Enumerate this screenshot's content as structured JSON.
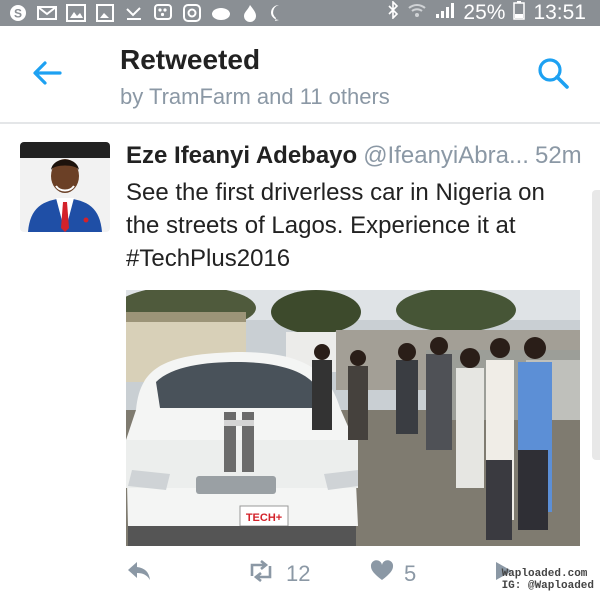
{
  "status_bar": {
    "battery": "25%",
    "time": "13:51",
    "icons": [
      "skype-icon",
      "mail-icon",
      "gallery-icon",
      "image-icon",
      "missed-call-icon",
      "bbm-icon",
      "instagram-icon",
      "cloud-icon",
      "fire-icon",
      "messenger-icon",
      "bluetooth-icon",
      "wifi-icon",
      "signal-icon",
      "battery-icon"
    ]
  },
  "header": {
    "title": "Retweeted",
    "subtitle": "by TramFarm and 11 others"
  },
  "tweet": {
    "author_name": "Eze Ifeanyi Adebayo",
    "handle": "@IfeanyiAbra...",
    "time": "52m",
    "text": "See the first driverless car in Nigeria on the streets of Lagos. Experience it at #TechPlus2016",
    "photo_badge": "TECH+",
    "retweet_count": "12",
    "like_count": "5"
  },
  "watermark": {
    "line1": "Waploaded.com",
    "line2": "IG: @Waploaded"
  },
  "colors": {
    "accent": "#1da1f2",
    "status_bar": "#8a8f94",
    "muted_text": "#8b98a5"
  }
}
